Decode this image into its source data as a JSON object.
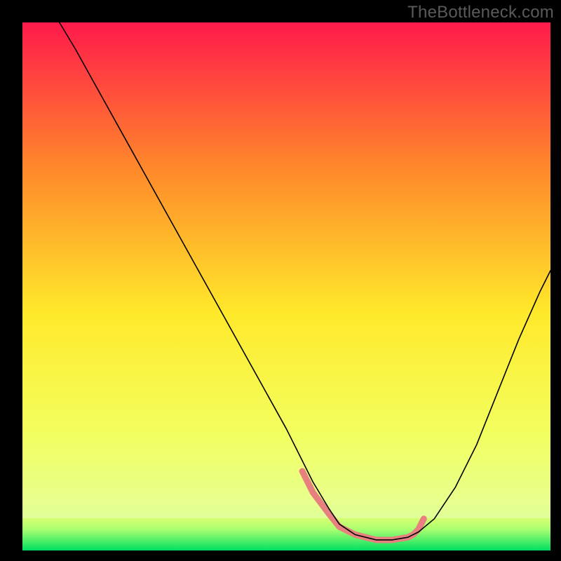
{
  "watermark": "TheBottleneck.com",
  "chart_data": {
    "type": "line",
    "title": "",
    "xlabel": "",
    "ylabel": "",
    "xlim": [
      0,
      100
    ],
    "ylim": [
      0,
      100
    ],
    "gradient_colors": {
      "top": "#ff1a4b",
      "upper_mid": "#ff8a2a",
      "mid": "#ffe92a",
      "lower_mid": "#f2ff60",
      "bottom_band_top": "#d4ff6a",
      "bottom_band_bottom": "#00e060"
    },
    "series": [
      {
        "name": "curve-black",
        "color": "#000000",
        "width": 1.6,
        "x": [
          7,
          10,
          15,
          20,
          25,
          30,
          35,
          40,
          45,
          50,
          55,
          58,
          60,
          63,
          67,
          70,
          73,
          75,
          78,
          82,
          86,
          90,
          94,
          98,
          100
        ],
        "y": [
          100,
          95,
          86,
          77,
          68,
          59,
          50,
          41,
          32,
          23,
          13,
          8,
          5,
          3,
          2,
          2,
          2.5,
          3.5,
          6,
          12,
          20,
          30,
          40,
          49,
          53
        ]
      },
      {
        "name": "curve-pink-overlay",
        "color": "#e98080",
        "width": 9,
        "x": [
          53,
          55,
          58,
          60,
          63,
          67,
          70,
          73,
          74,
          75,
          76
        ],
        "y": [
          15,
          11,
          7,
          4.5,
          3,
          2,
          2,
          2.5,
          3,
          4,
          6
        ]
      }
    ]
  }
}
